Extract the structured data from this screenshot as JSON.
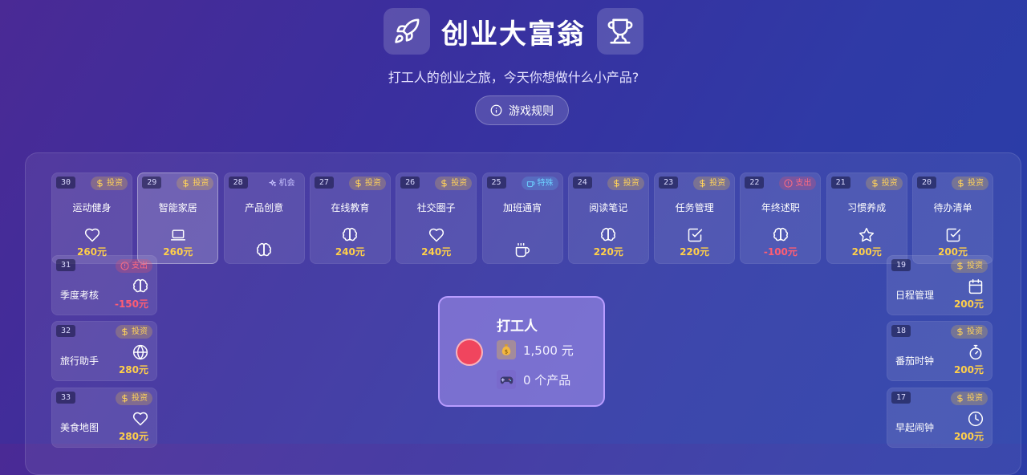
{
  "header": {
    "title": "创业大富翁",
    "subtitle": "打工人的创业之旅，今天你想做什么小产品?",
    "rules_label": "游戏规则",
    "left_icon": "rocket-icon",
    "right_icon": "trophy-icon"
  },
  "badges": {
    "invest": "投资",
    "expense": "支出",
    "chance": "机会",
    "special": "特殊"
  },
  "colors": {
    "invest": "#ffd25a",
    "expense": "#ff5d73",
    "special": "#6cd0ff",
    "token": "#f0455e"
  },
  "cells": [
    {
      "num": "30",
      "type": "invest",
      "name": "运动健身",
      "icon": "heart-icon",
      "value": "260元"
    },
    {
      "num": "29",
      "type": "invest",
      "name": "智能家居",
      "icon": "laptop-icon",
      "value": "260元",
      "highlight": true
    },
    {
      "num": "28",
      "type": "chance",
      "name": "产品创意",
      "icon": "brain-icon",
      "value": ""
    },
    {
      "num": "27",
      "type": "invest",
      "name": "在线教育",
      "icon": "brain-icon",
      "value": "240元"
    },
    {
      "num": "26",
      "type": "invest",
      "name": "社交圈子",
      "icon": "heart-icon",
      "value": "240元"
    },
    {
      "num": "25",
      "type": "special",
      "name": "加班通宵",
      "icon": "coffee-icon",
      "value": ""
    },
    {
      "num": "24",
      "type": "invest",
      "name": "阅读笔记",
      "icon": "brain-icon",
      "value": "220元"
    },
    {
      "num": "23",
      "type": "invest",
      "name": "任务管理",
      "icon": "checkbox-icon",
      "value": "220元"
    },
    {
      "num": "22",
      "type": "expense",
      "name": "年终述职",
      "icon": "brain-icon",
      "value": "-100元"
    },
    {
      "num": "21",
      "type": "invest",
      "name": "习惯养成",
      "icon": "star-icon",
      "value": "200元"
    },
    {
      "num": "20",
      "type": "invest",
      "name": "待办清单",
      "icon": "checkbox-icon",
      "value": "200元"
    },
    {
      "num": "31",
      "type": "expense",
      "name": "季度考核",
      "icon": "brain-icon",
      "value": "-150元"
    },
    {
      "num": "32",
      "type": "invest",
      "name": "旅行助手",
      "icon": "globe-icon",
      "value": "280元"
    },
    {
      "num": "33",
      "type": "invest",
      "name": "美食地图",
      "icon": "heart-icon",
      "value": "280元"
    },
    {
      "num": "19",
      "type": "invest",
      "name": "日程管理",
      "icon": "calendar-icon",
      "value": "200元"
    },
    {
      "num": "18",
      "type": "invest",
      "name": "番茄时钟",
      "icon": "stopwatch-icon",
      "value": "200元"
    },
    {
      "num": "17",
      "type": "invest",
      "name": "早起闹钟",
      "icon": "clock-icon",
      "value": "200元"
    }
  ],
  "player": {
    "name": "打工人",
    "money": "1,500 元",
    "products": "0 个产品",
    "money_icon": "money-bag-icon",
    "products_icon": "gamepad-icon"
  }
}
